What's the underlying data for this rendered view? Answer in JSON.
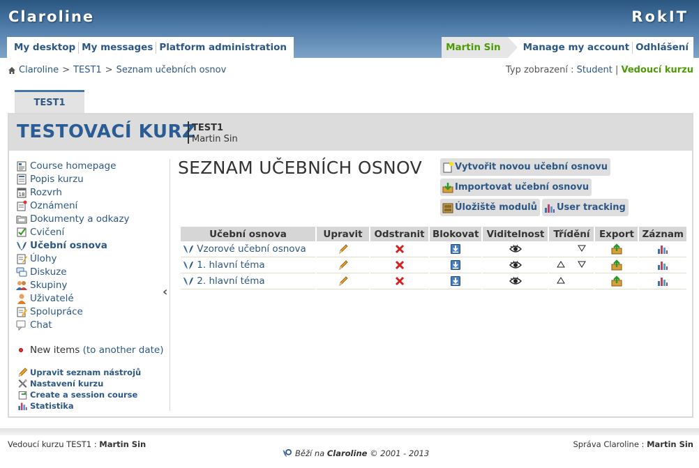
{
  "header": {
    "site_name": "Claroline",
    "institution": "RokIT",
    "main_nav": [
      "My desktop",
      "My messages",
      "Platform administration"
    ],
    "user_name": "Martin Sin",
    "user_links": [
      "Manage my account",
      "Odhlášení"
    ]
  },
  "breadcrumb": {
    "items": [
      "Claroline",
      "TEST1",
      "Seznam učebních osnov"
    ],
    "separator": ">"
  },
  "view_mode": {
    "label": "Typ zobrazení :",
    "student": "Student",
    "separator": "|",
    "teacher": "Vedoucí kurzu"
  },
  "course": {
    "tab": "TEST1",
    "title": "TESTOVACÍ KURZ",
    "code": "TEST1",
    "teacher": "Martin Sin"
  },
  "sidebar": {
    "tools": [
      {
        "label": "Course homepage",
        "icon": "course-homepage-icon"
      },
      {
        "label": "Popis kurzu",
        "icon": "description-icon"
      },
      {
        "label": "Rozvrh",
        "icon": "calendar-icon"
      },
      {
        "label": "Oznámení",
        "icon": "announcement-icon"
      },
      {
        "label": "Dokumenty a odkazy",
        "icon": "folder-icon"
      },
      {
        "label": "Cvičení",
        "icon": "checkbox-icon"
      },
      {
        "label": "Učební osnova",
        "icon": "learning-path-icon"
      },
      {
        "label": "Úlohy",
        "icon": "assignment-icon"
      },
      {
        "label": "Diskuze",
        "icon": "forum-icon"
      },
      {
        "label": "Skupiny",
        "icon": "group-icon"
      },
      {
        "label": "Uživatelé",
        "icon": "user-icon"
      },
      {
        "label": "Spolupráce",
        "icon": "wiki-icon"
      },
      {
        "label": "Chat",
        "icon": "chat-icon"
      }
    ],
    "active_index": 6,
    "new_items": "New items",
    "new_items_link": "(to another date)",
    "admin": [
      {
        "label": "Upravit seznam nástrojů",
        "icon": "pencil-icon"
      },
      {
        "label": "Nastavení kurzu",
        "icon": "tools-icon"
      },
      {
        "label": "Create a session course",
        "icon": "session-icon"
      },
      {
        "label": "Statistika",
        "icon": "statistics-icon"
      }
    ]
  },
  "main": {
    "heading": "SEZNAM UČEBNÍCH OSNOV",
    "commands": {
      "create": "Vytvořit novou učební osnovu",
      "import": "Importovat učební osnovu",
      "repository": "Úložiště modulů",
      "tracking": "User tracking"
    },
    "table": {
      "columns": [
        "Učební osnova",
        "Upravit",
        "Odstranit",
        "Blokovat",
        "Viditelnost",
        "Třídění",
        "Export",
        "Záznam"
      ],
      "rows": [
        {
          "name": "Vzorové učební osnova",
          "sort_up": false,
          "sort_down": true
        },
        {
          "name": "1. hlavní téma",
          "sort_up": true,
          "sort_down": true
        },
        {
          "name": "2. hlavní téma",
          "sort_up": true,
          "sort_down": false
        }
      ]
    }
  },
  "footer": {
    "left_label": "Vedoucí kurzu TEST1 :",
    "left_name": "Martin Sin",
    "right_label": "Správa Claroline :",
    "right_name": "Martin Sin",
    "powered_prefix": "Běží na",
    "powered_brand": "Claroline",
    "powered_suffix": "© 2001 - 2013"
  },
  "colors": {
    "header_blue": "#2a5680",
    "link_blue": "#2d5785",
    "active_green": "#4e9a06",
    "table_header": "#d6d6d6"
  }
}
